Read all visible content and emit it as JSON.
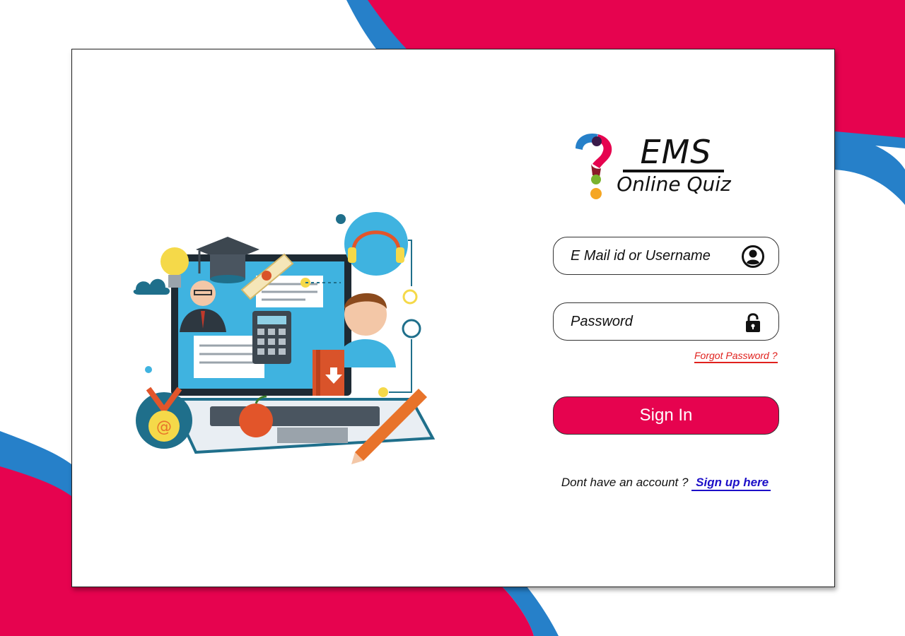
{
  "brand": {
    "title": "EMS",
    "subtitle": "Online Quiz"
  },
  "login": {
    "username_placeholder": "E Mail id or Username",
    "username_icon": "user-circle-icon",
    "password_placeholder": "Password",
    "password_icon": "lock-icon",
    "forgot_password": "Forgot Password ?",
    "sign_in": "Sign In",
    "no_account_text": "Dont have an account ?",
    "sign_up_link": "Sign up here"
  },
  "colors": {
    "accent": "#e6034f",
    "secondary": "#2680c9",
    "link": "#1d0fc8",
    "forgot": "#e0211d"
  }
}
